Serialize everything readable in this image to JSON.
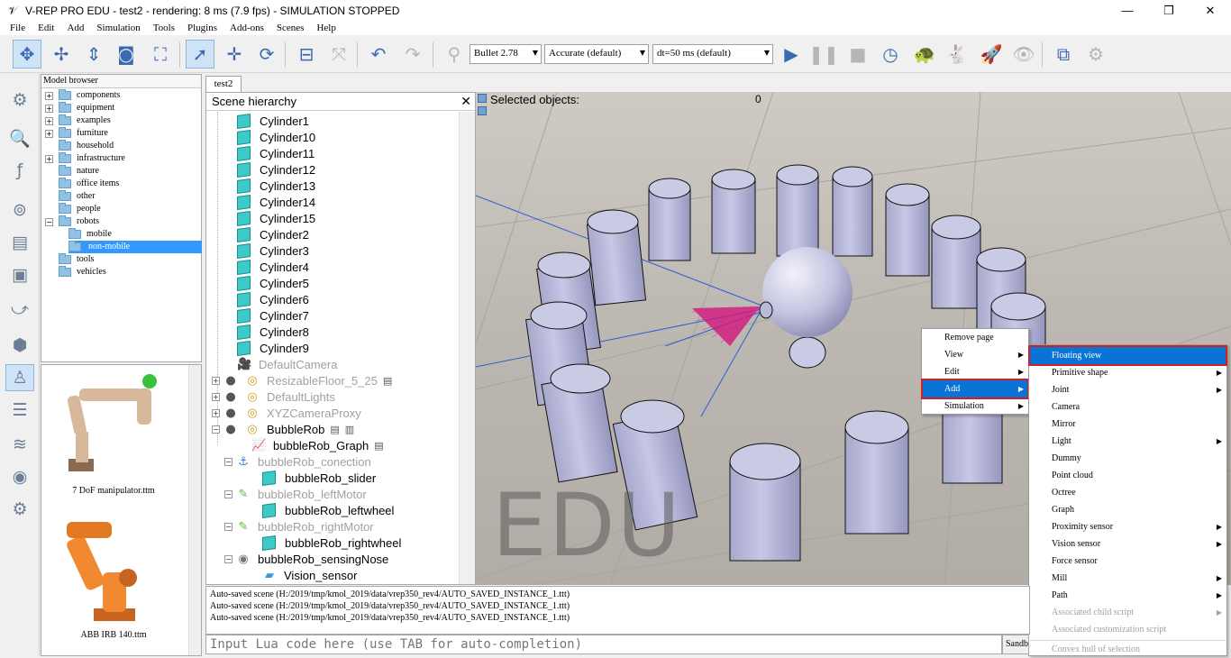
{
  "window": {
    "title": "V-REP PRO EDU - test2 - rendering: 8 ms (7.9 fps) - SIMULATION STOPPED",
    "minimize": "—",
    "restore": "❐",
    "close": "✕"
  },
  "menu": [
    "File",
    "Edit",
    "Add",
    "Simulation",
    "Tools",
    "Plugins",
    "Add-ons",
    "Scenes",
    "Help"
  ],
  "toolbar": {
    "engine": "Bullet 2.78",
    "accuracy": "Accurate (default)",
    "timestep": "dt=50 ms (default)"
  },
  "model_browser": {
    "header": "Model browser",
    "items": [
      {
        "label": "components",
        "expandable": true
      },
      {
        "label": "equipment",
        "expandable": true
      },
      {
        "label": "examples",
        "expandable": true
      },
      {
        "label": "furniture",
        "expandable": true
      },
      {
        "label": "household",
        "expandable": false
      },
      {
        "label": "infrastructure",
        "expandable": true
      },
      {
        "label": "nature",
        "expandable": false
      },
      {
        "label": "office items",
        "expandable": false
      },
      {
        "label": "other",
        "expandable": false
      },
      {
        "label": "people",
        "expandable": false
      },
      {
        "label": "robots",
        "expandable": true
      },
      {
        "label": "mobile",
        "expandable": false
      },
      {
        "label": "non-mobile",
        "expandable": false
      },
      {
        "label": "tools",
        "expandable": false
      },
      {
        "label": "vehicles",
        "expandable": false
      }
    ],
    "thumbnails": [
      "7 DoF manipulator.ttm",
      "ABB IRB 140.ttm"
    ]
  },
  "tab": "test2",
  "hierarchy": {
    "header": "Scene hierarchy",
    "items": [
      {
        "label": "Cylinder1"
      },
      {
        "label": "Cylinder10"
      },
      {
        "label": "Cylinder11"
      },
      {
        "label": "Cylinder12"
      },
      {
        "label": "Cylinder13"
      },
      {
        "label": "Cylinder14"
      },
      {
        "label": "Cylinder15"
      },
      {
        "label": "Cylinder2"
      },
      {
        "label": "Cylinder3"
      },
      {
        "label": "Cylinder4"
      },
      {
        "label": "Cylinder5"
      },
      {
        "label": "Cylinder6"
      },
      {
        "label": "Cylinder7"
      },
      {
        "label": "Cylinder8"
      },
      {
        "label": "Cylinder9"
      },
      {
        "label": "DefaultCamera"
      },
      {
        "label": "ResizableFloor_5_25"
      },
      {
        "label": "DefaultLights"
      },
      {
        "label": "XYZCameraProxy"
      },
      {
        "label": "BubbleRob"
      },
      {
        "label": "bubbleRob_Graph"
      },
      {
        "label": "bubbleRob_conection"
      },
      {
        "label": "bubbleRob_slider"
      },
      {
        "label": "bubbleRob_leftMotor"
      },
      {
        "label": "bubbleRob_leftwheel"
      },
      {
        "label": "bubbleRob_rightMotor"
      },
      {
        "label": "bubbleRob_rightwheel"
      },
      {
        "label": "bubbleRob_sensingNose"
      },
      {
        "label": "Vision_sensor"
      }
    ]
  },
  "viewport": {
    "selected_label": "Selected objects:",
    "selected_count": "0",
    "watermark": "EDU"
  },
  "context_menu": {
    "items": [
      "Remove page",
      "View",
      "Edit",
      "Add",
      "Simulation"
    ]
  },
  "add_submenu": {
    "items": [
      {
        "label": "Floating view"
      },
      {
        "label": "Primitive shape"
      },
      {
        "label": "Joint"
      },
      {
        "label": "Camera"
      },
      {
        "label": "Mirror"
      },
      {
        "label": "Light"
      },
      {
        "label": "Dummy"
      },
      {
        "label": "Point cloud"
      },
      {
        "label": "Octree"
      },
      {
        "label": "Graph"
      },
      {
        "label": "Proximity sensor"
      },
      {
        "label": "Vision sensor"
      },
      {
        "label": "Force sensor"
      },
      {
        "label": "Mill"
      },
      {
        "label": "Path"
      },
      {
        "label": "Associated child script"
      },
      {
        "label": "Associated customization script"
      },
      {
        "label": "Convex hull of selection"
      }
    ]
  },
  "console": {
    "lines": [
      "Auto-saved scene (H:/2019/tmp/kmol_2019/data/vrep350_rev4/AUTO_SAVED_INSTANCE_1.ttt)",
      "Auto-saved scene (H:/2019/tmp/kmol_2019/data/vrep350_rev4/AUTO_SAVED_INSTANCE_1.ttt)",
      "Auto-saved scene (H:/2019/tmp/kmol_2019/data/vrep350_rev4/AUTO_SAVED_INSTANCE_1.ttt)"
    ],
    "input_placeholder": "Input Lua code here (use TAB for auto-completion)",
    "sandbox_label": "Sandbox"
  }
}
